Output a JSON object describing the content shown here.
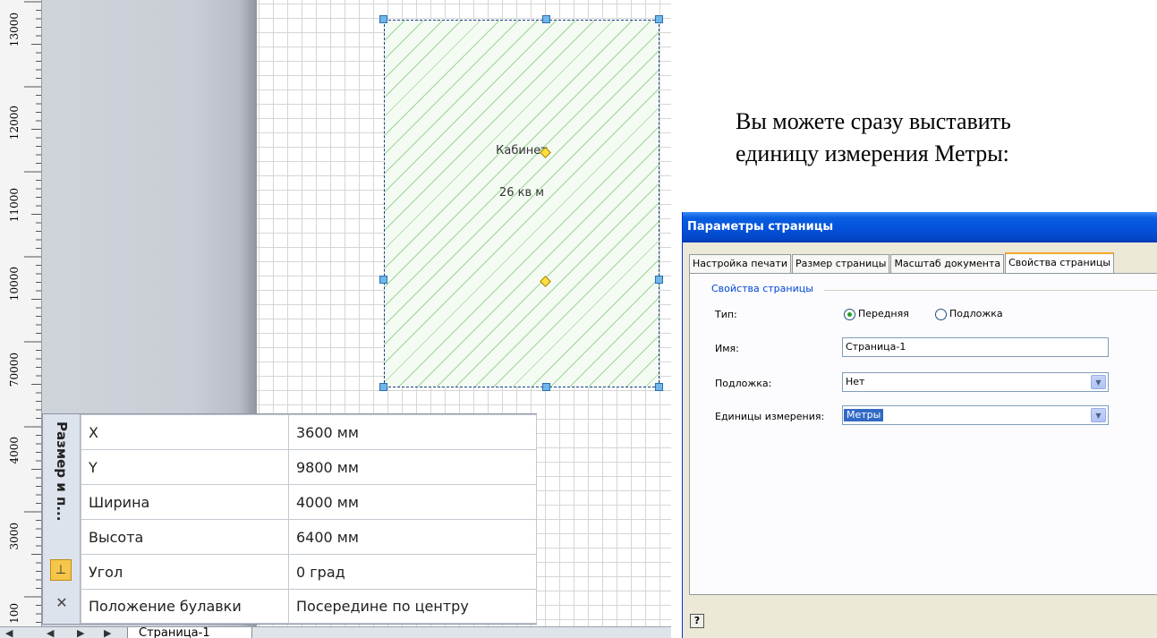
{
  "ruler": {
    "labels": [
      "13000",
      "12000",
      "11000",
      "10000",
      "70000",
      "4000",
      "3000",
      "100"
    ]
  },
  "drawing": {
    "shape_title": "Кабинет",
    "shape_area": "26 кв м",
    "fill_color": "#82c878",
    "border_color": "#1a3d8a"
  },
  "page_tabs": {
    "first": "◀",
    "prev": "◀",
    "next": "▶",
    "last": "▶",
    "current_page": "Страница-1"
  },
  "size_position": {
    "title": "Размер и п...",
    "pin_icon": "pin-icon",
    "close_icon": "close-icon",
    "rows": [
      {
        "prop": "X",
        "value": "3600 мм"
      },
      {
        "prop": "Y",
        "value": "9800 мм"
      },
      {
        "prop": "Ширина",
        "value": "4000 мм"
      },
      {
        "prop": "Высота",
        "value": "6400 мм"
      },
      {
        "prop": "Угол",
        "value": "0 град"
      },
      {
        "prop": "Положение булавки",
        "value": "Посередине по центру"
      }
    ]
  },
  "caption": {
    "line1": "Вы можете сразу выставить",
    "line2": "единицу измерения Метры:"
  },
  "dialog": {
    "title": "Параметры страницы",
    "tabs": [
      "Настройка печати",
      "Размер страницы",
      "Масштаб документа",
      "Свойства страницы"
    ],
    "active_tab": "Свойства страницы",
    "group_label": "Свойства страницы",
    "type_label": "Тип:",
    "type_options": [
      "Передняя",
      "Подложка"
    ],
    "type_selected": "Передняя",
    "name_label": "Имя:",
    "name_value": "Страница-1",
    "background_label": "Подложка:",
    "background_value": "Нет",
    "units_label": "Единицы измерения:",
    "units_value": "Метры",
    "help_label": "?",
    "title_color": "#0454dd",
    "active_tab_accent": "#f4a62a"
  }
}
